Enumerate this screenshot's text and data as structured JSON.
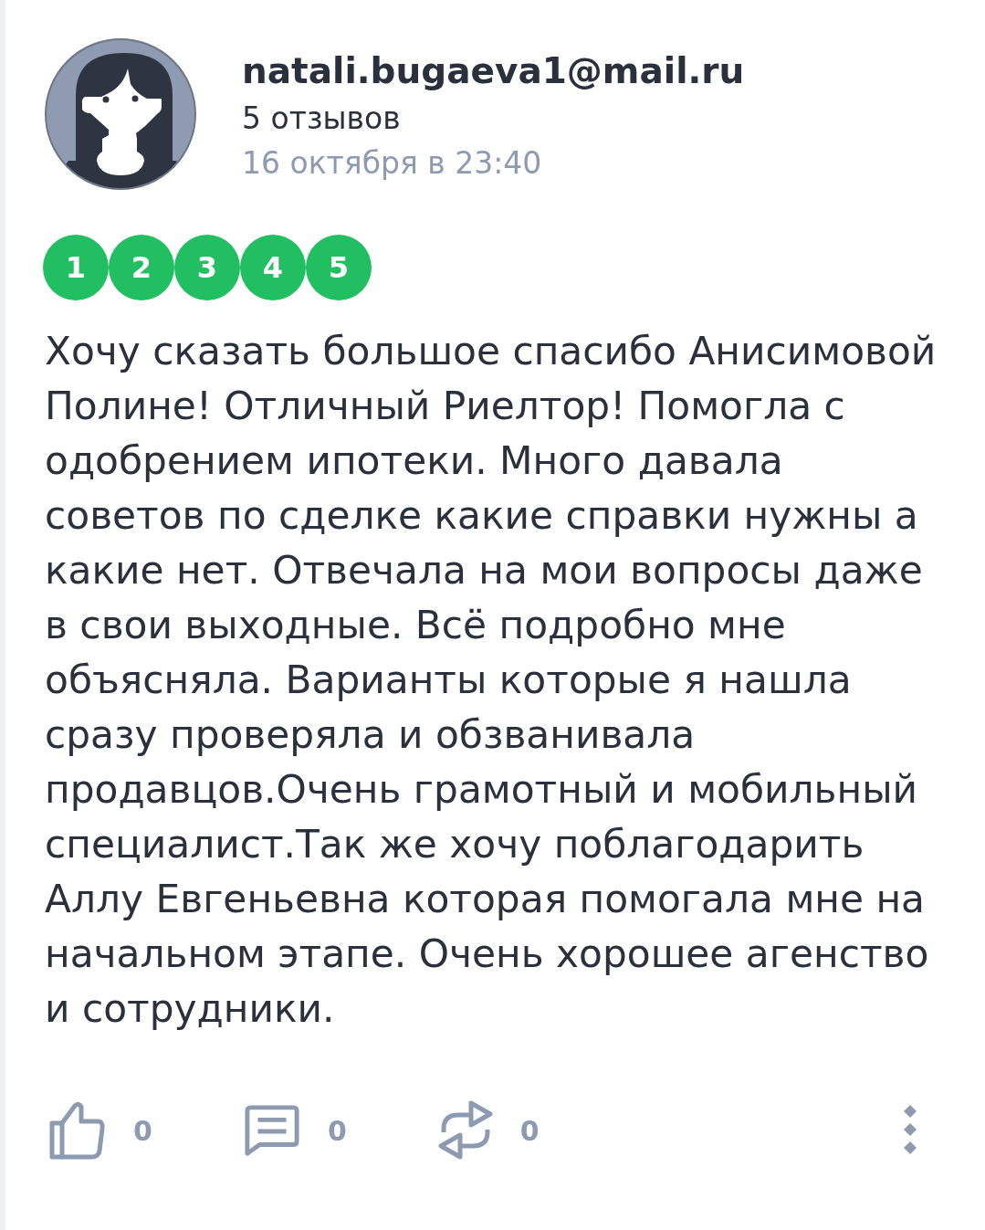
{
  "review": {
    "author": {
      "name": "natali.bugaeva1@mail.ru",
      "reviews_count": "5 отзывов",
      "date": "16 октября в 23:40"
    },
    "rating": {
      "points": [
        {
          "label": "1",
          "on": true
        },
        {
          "label": "2",
          "on": true
        },
        {
          "label": "3",
          "on": true
        },
        {
          "label": "4",
          "on": true
        },
        {
          "label": "5",
          "on": true
        }
      ]
    },
    "text": "Хочу сказать большое спасибо Анисимовой Полине! Отличный Риелтор! Помогла с одобрением ипотеки. Много давала советов по сделке какие справки нужны а какие нет. Отвечала на мои вопросы даже в свои выходные. Всё подробно мне объясняла. Варианты которые я нашла сразу проверяла и обзванивала продавцов.Очень грамотный и мобильный специалист.Так же хочу поблагодарить Аллу Евгеньевна которая помогала мне на начальном этапе. Очень хорошее агенство и сотрудники."
  },
  "actions": [
    {
      "kind": "like",
      "count": "0"
    },
    {
      "kind": "comment",
      "count": "0"
    },
    {
      "kind": "repost",
      "count": "0"
    },
    {
      "kind": "more"
    }
  ]
}
